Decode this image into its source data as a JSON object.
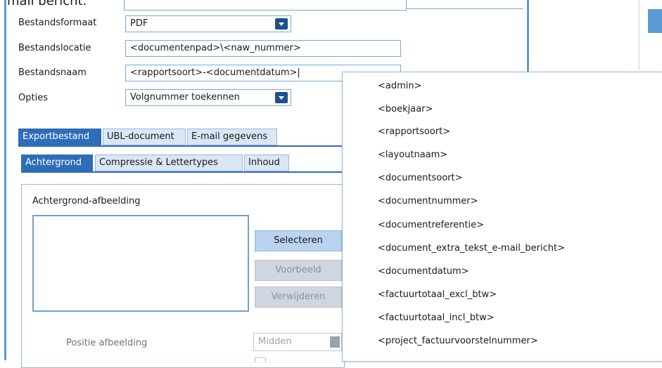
{
  "window": {
    "partial_title": "mail bericht."
  },
  "form": {
    "bestandsformaat_label": "Bestandsformaat",
    "bestandsformaat_value": "PDF",
    "bestandslocatie_label": "Bestandslocatie",
    "bestandslocatie_value": "<documentenpad>\\<naw_nummer>",
    "bestandsnaam_label": "Bestandsnaam",
    "bestandsnaam_value": "<rapportsoort>-<documentdatum>|",
    "opties_label": "Opties",
    "opties_value": "Volgnummer toekennen"
  },
  "tabs": {
    "top": [
      "Exportbestand",
      "UBL-document",
      "E-mail gegevens"
    ],
    "sub": [
      "Achtergrond",
      "Compressie & Lettertypes",
      "Inhoud"
    ]
  },
  "background": {
    "section_title": "Achtergrond-afbeelding",
    "select_button": "Selecteren",
    "preview_button": "Voorbeeld",
    "remove_button": "Verwijderen",
    "position_label": "Positie afbeelding",
    "position_value": "Midden"
  },
  "dropdown": {
    "items": [
      "<admin>",
      "<boekjaar>",
      "<rapportsoort>",
      "<layoutnaam>",
      "<documentsoort>",
      "<documentnummer>",
      "<documentreferentie>",
      "<document_extra_tekst_e-mail_bericht>",
      "<documentdatum>",
      "<factuurtotaal_excl_btw>",
      "<factuurtotaal_incl_btw>",
      "<project_factuurvoorstelnummer>"
    ]
  },
  "colors": {
    "accent": "#2f6db8",
    "field_border": "#7aa7d6",
    "button_primary": "#b9d3f0",
    "button_disabled": "#cfd6df"
  },
  "icons": [
    "chevron-down-icon"
  ]
}
